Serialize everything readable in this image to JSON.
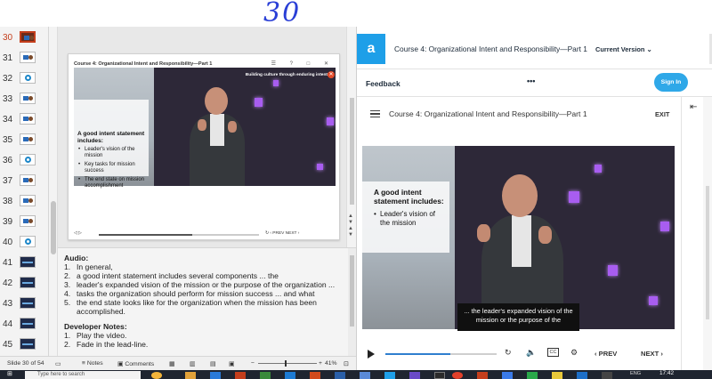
{
  "annotation": "30",
  "thumbnails": [
    {
      "num": "30",
      "kind": "active"
    },
    {
      "num": "31",
      "kind": "photo"
    },
    {
      "num": "32",
      "kind": "circle"
    },
    {
      "num": "33",
      "kind": "photo"
    },
    {
      "num": "34",
      "kind": "photo"
    },
    {
      "num": "35",
      "kind": "photo"
    },
    {
      "num": "36",
      "kind": "circle"
    },
    {
      "num": "37",
      "kind": "photo"
    },
    {
      "num": "38",
      "kind": "photo"
    },
    {
      "num": "39",
      "kind": "photo"
    },
    {
      "num": "40",
      "kind": "circle"
    },
    {
      "num": "41",
      "kind": "dark"
    },
    {
      "num": "42",
      "kind": "dark"
    },
    {
      "num": "43",
      "kind": "dark"
    },
    {
      "num": "44",
      "kind": "dark"
    },
    {
      "num": "45",
      "kind": "dark"
    }
  ],
  "slide": {
    "title": "Course 4: Organizational Intent and Responsibility—Part 1",
    "window_buttons": "☰ ? □ ✕",
    "banner": "Building culture through enduring intent",
    "banner_close": "✕",
    "text_heading": "A good intent statement includes:",
    "bullets": [
      "Leader's vision of the mission",
      "Key tasks for mission success",
      "The end state on mission accomplishment"
    ],
    "controls_left": "◁  ▷",
    "controls_right": "↻   ‹ PREV   NEXT ›"
  },
  "notes": {
    "audio_heading": "Audio:",
    "audio_lines": [
      {
        "n": "1.",
        "text": "In general,"
      },
      {
        "n": "2.",
        "text": "a good intent statement includes several components ... the"
      },
      {
        "n": "3.",
        "text": "leader's expanded vision of the mission or the purpose of the organization ..."
      },
      {
        "n": "4.",
        "text": "tasks the organization should perform for mission success ... and what"
      },
      {
        "n": "5.",
        "text": "the end state looks like for the organization when the mission has been accomplished."
      }
    ],
    "dev_heading": "Developer Notes:",
    "dev_lines": [
      {
        "n": "1.",
        "text": "Play the video."
      },
      {
        "n": "2.",
        "text": "Fade in the lead-line."
      }
    ]
  },
  "status": {
    "slide": "Slide 30 of 54",
    "notes": "Notes",
    "comments": "Comments",
    "zoom": "41%"
  },
  "player": {
    "logo": "a",
    "course_title": "Course 4: Organizational Intent and Responsibility—Part 1",
    "version": "Current Version",
    "feedback": "Feedback",
    "more": "•••",
    "sign_in": "Sign In",
    "content_title": "Course 4: Organizational Intent and Responsibility—Part 1",
    "exit": "EXIT",
    "video_heading": "A good intent statement includes:",
    "video_bullets": [
      "Leader's vision of the mission"
    ],
    "caption": "... the leader's expanded vision of the mission or the purpose of the",
    "cc": "CC",
    "prev": "‹ PREV",
    "next": "NEXT ›",
    "progress": 0.58
  },
  "taskbar": {
    "search": "Type here to search",
    "time": "17:42",
    "lang": "ENG"
  },
  "colors": {
    "accent": "#1e9fe8",
    "ppt_active": "#c43e1c",
    "lamp": "#a85df0"
  }
}
